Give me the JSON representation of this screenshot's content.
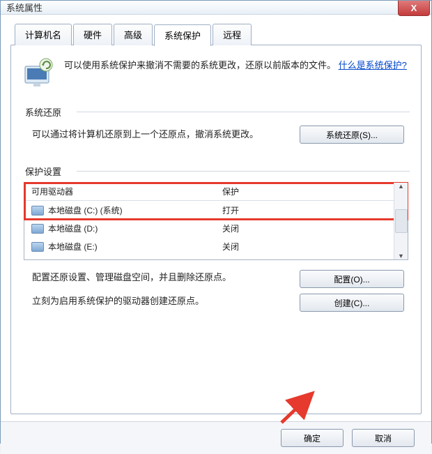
{
  "window": {
    "title": "系统属性",
    "close": "X"
  },
  "tabs": {
    "items": [
      {
        "label": "计算机名"
      },
      {
        "label": "硬件"
      },
      {
        "label": "高级"
      },
      {
        "label": "系统保护",
        "selected": true
      },
      {
        "label": "远程"
      }
    ]
  },
  "intro": {
    "text1": "可以使用系统保护来撤消不需要的系统更改，还原以前版本的文件。",
    "link": "什么是系统保护?"
  },
  "restore": {
    "group_label": "系统还原",
    "text": "可以通过将计算机还原到上一个还原点，撤消系统更改。",
    "button": "系统还原(S)..."
  },
  "protection": {
    "group_label": "保护设置",
    "columns": {
      "drive": "可用驱动器",
      "status": "保护"
    },
    "drives": [
      {
        "name": "本地磁盘 (C:) (系统)",
        "status": "打开"
      },
      {
        "name": "本地磁盘 (D:)",
        "status": "关闭"
      },
      {
        "name": "本地磁盘 (E:)",
        "status": "关闭"
      }
    ],
    "config_text": "配置还原设置、管理磁盘空间，并且删除还原点。",
    "config_button": "配置(O)...",
    "create_text": "立刻为启用系统保护的驱动器创建还原点。",
    "create_button": "创建(C)..."
  },
  "footer": {
    "ok": "确定",
    "cancel": "取消"
  }
}
